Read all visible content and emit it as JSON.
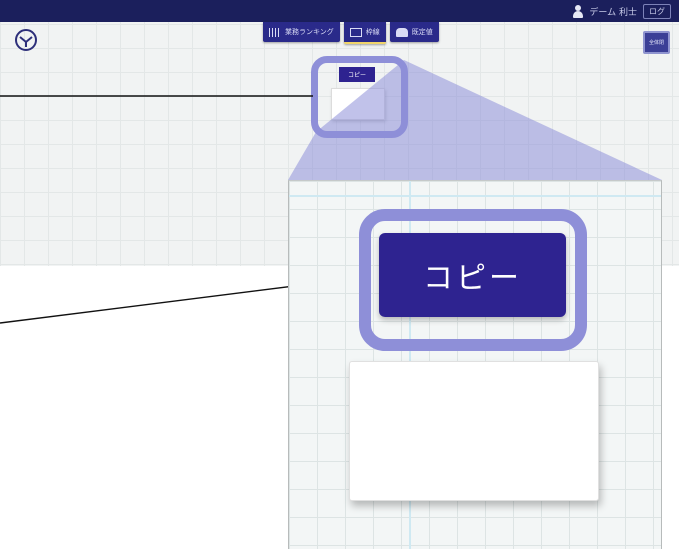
{
  "header": {
    "user_name": "デーム 利士",
    "logout_label": "ログ"
  },
  "tabs": [
    {
      "label": "業務ランキング",
      "icon": "grid-icon",
      "active": false
    },
    {
      "label": "枠線",
      "icon": "box-icon",
      "active": true
    },
    {
      "label": "既定値",
      "icon": "tray-icon",
      "active": false
    }
  ],
  "corner_button": {
    "label": "全体閉"
  },
  "preview": {
    "copy_button_label": "コピー",
    "zoomed_copy_button_label": "コピー"
  },
  "colors": {
    "topbar": "#1b1f5c",
    "button": "#2e2390",
    "highlight": "#8e8fd8",
    "canvas": "#f1f3f3"
  }
}
